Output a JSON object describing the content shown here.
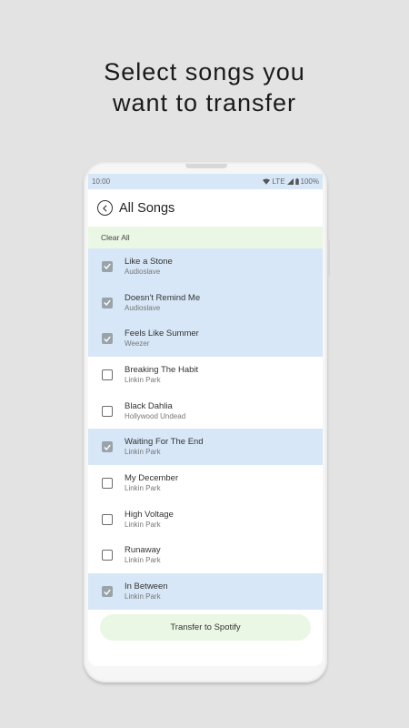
{
  "headline": {
    "line1": "Select songs you",
    "line2": "want to transfer"
  },
  "status": {
    "time": "10:00",
    "network": "LTE",
    "battery": "100%"
  },
  "header": {
    "title": "All Songs"
  },
  "toolbar": {
    "clear_label": "Clear All"
  },
  "songs": [
    {
      "title": "Like a Stone",
      "artist": "Audioslave",
      "selected": true
    },
    {
      "title": "Doesn't Remind Me",
      "artist": "Audioslave",
      "selected": true
    },
    {
      "title": "Feels Like Summer",
      "artist": "Weezer",
      "selected": true
    },
    {
      "title": "Breaking The Habit",
      "artist": "Linkin Park",
      "selected": false
    },
    {
      "title": "Black Dahlia",
      "artist": "Hollywood Undead",
      "selected": false
    },
    {
      "title": "Waiting For The End",
      "artist": "Linkin Park",
      "selected": true
    },
    {
      "title": "My December",
      "artist": "Linkin Park",
      "selected": false
    },
    {
      "title": "High Voltage",
      "artist": "Linkin Park",
      "selected": false
    },
    {
      "title": "Runaway",
      "artist": "Linkin Park",
      "selected": false
    },
    {
      "title": "In Between",
      "artist": "Linkin Park",
      "selected": true
    }
  ],
  "footer": {
    "transfer_label": "Transfer to Spotify"
  },
  "colors": {
    "selected_row": "#d7e7f7",
    "accent_green": "#eaf7e4",
    "checkbox_checked": "#9aa3a9"
  }
}
